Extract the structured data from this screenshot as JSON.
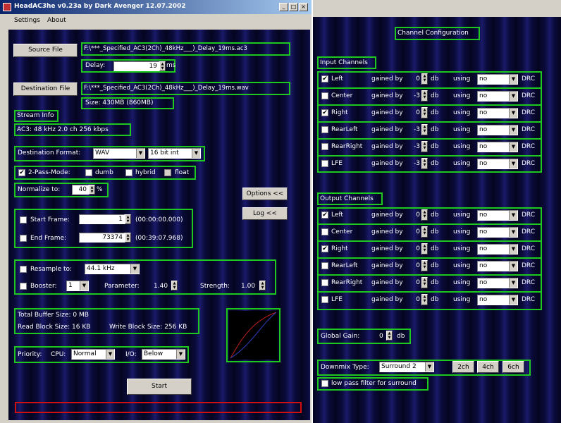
{
  "left_window": {
    "title": "HeadAC3he v0.23a by Dark Avenger 12.07.2002",
    "menu": [
      "Settings",
      "About"
    ],
    "source": {
      "button": "Source File",
      "path": "F:\\***_Specified_AC3(2Ch)_48kHz___)_Delay_19ms.ac3",
      "delay_label": "Delay:",
      "delay_value": "19",
      "delay_unit": "ms"
    },
    "destination": {
      "button": "Destination File",
      "path": "F:\\***_Specified_AC3(2Ch)_48kHz___)_Delay_19ms.wav",
      "size": "Size:  430MB (860MB)"
    },
    "stream_info_label": "Stream Info",
    "stream_info_value": "AC3:  48 kHz   2.0 ch   256 kbps",
    "dest_format": {
      "label": "Destination Format:",
      "format": "WAV",
      "bits": "16 bit int"
    },
    "two_pass": {
      "label": "2-Pass-Mode:",
      "dumb": "dumb",
      "hybrid": "hybrid",
      "float": "float"
    },
    "normalize": {
      "label": "Normalize to:",
      "value": "40",
      "unit": "%"
    },
    "options_button": "Options <<",
    "log_button": "Log <<",
    "start_frame": {
      "label": "Start Frame:",
      "value": "1",
      "time": "(00:00:00.000)"
    },
    "end_frame": {
      "label": "End Frame:",
      "value": "73374",
      "time": "(00:39:07.968)"
    },
    "resample": {
      "label": "Resample to:",
      "value": "44.1 kHz"
    },
    "booster": {
      "label": "Booster:",
      "value": "1",
      "parameter_label": "Parameter:",
      "parameter_value": "1.40",
      "strength_label": "Strength:",
      "strength_value": "1.00"
    },
    "buffer": {
      "total": "Total Buffer Size:   0 MB",
      "read": "Read Block Size:  16 KB",
      "write": "Write Block Size:  256 KB"
    },
    "priority": {
      "label": "Priority:",
      "cpu_label": "CPU:",
      "cpu_value": "Normal",
      "io_label": "I/O:",
      "io_value": "Below"
    },
    "start_button": "Start"
  },
  "right_window": {
    "title": "Channel Configuration",
    "input_label": "Input Channels",
    "output_label": "Output Channels",
    "gained_by": "gained by",
    "db": "db",
    "using": "using",
    "drc": "DRC",
    "input_channels": [
      {
        "name": "Left",
        "checked": true,
        "gain": "0",
        "using": "no"
      },
      {
        "name": "Center",
        "checked": false,
        "gain": "-3",
        "using": "no"
      },
      {
        "name": "Right",
        "checked": true,
        "gain": "0",
        "using": "no"
      },
      {
        "name": "RearLeft",
        "checked": false,
        "gain": "-3",
        "using": "no"
      },
      {
        "name": "RearRight",
        "checked": false,
        "gain": "-3",
        "using": "no"
      },
      {
        "name": "LFE",
        "checked": false,
        "gain": "-3",
        "using": "no"
      }
    ],
    "output_channels": [
      {
        "name": "Left",
        "checked": true,
        "gain": "0",
        "using": "no"
      },
      {
        "name": "Center",
        "checked": false,
        "gain": "0",
        "using": "no"
      },
      {
        "name": "Right",
        "checked": true,
        "gain": "0",
        "using": "no"
      },
      {
        "name": "RearLeft",
        "checked": false,
        "gain": "0",
        "using": "no"
      },
      {
        "name": "RearRight",
        "checked": false,
        "gain": "0",
        "using": "no"
      },
      {
        "name": "LFE",
        "checked": false,
        "gain": "0",
        "using": "no"
      }
    ],
    "global_gain": {
      "label": "Global Gain:",
      "value": "0",
      "unit": "db"
    },
    "downmix": {
      "label": "Downmix Type:",
      "value": "Surround 2",
      "buttons": [
        "2ch",
        "4ch",
        "6ch"
      ]
    },
    "lowpass_label": "low pass filter for surround"
  },
  "colors": {
    "group_border": "#1ec81e",
    "progress_border": "#d01010",
    "titlebar": "#0a246a"
  },
  "icons": {
    "checked": "✔",
    "spin_up": "▲",
    "spin_down": "▼",
    "dropdown": "▼"
  }
}
